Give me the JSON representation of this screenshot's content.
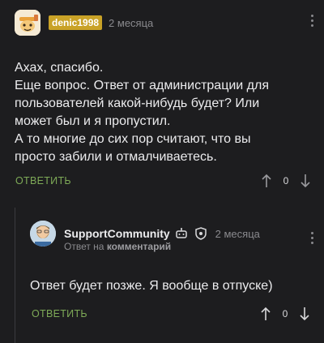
{
  "comment1": {
    "username": "denic1998",
    "time": "2 месяца",
    "lines": [
      "Ахах, спасибо.",
      "Еще вопрос. Ответ от администрации для",
      "пользователей какой-нибудь будет? Или",
      "может был и я пропустил.",
      "А то многие до сих пор считают, что вы",
      "просто забили и отмалчиваетесь."
    ],
    "reply_label": "ОТВЕТИТЬ",
    "score": "0"
  },
  "comment2": {
    "username": "SupportCommunity",
    "time": "2 месяца",
    "reply_prefix": "Ответ на",
    "reply_target": "комментарий",
    "text": "Ответ будет позже. Я вообще в отпуске)",
    "reply_label": "ОТВЕТИТЬ",
    "score": "0"
  },
  "colors": {
    "background": "#1d1d1f",
    "username_badge": "#c9a227",
    "reply_button": "#7eaa57",
    "meta_text": "#8a8a8e"
  },
  "icons": {
    "comment1_avatar": "cartoon-avatar",
    "comment2_avatar": "bearded-man-avatar",
    "staff_badge": "robot-icon",
    "shield_badge": "shield-icon",
    "more_menu": "kebab-menu-icon",
    "upvote": "arrow-up-icon",
    "downvote": "arrow-down-icon"
  }
}
